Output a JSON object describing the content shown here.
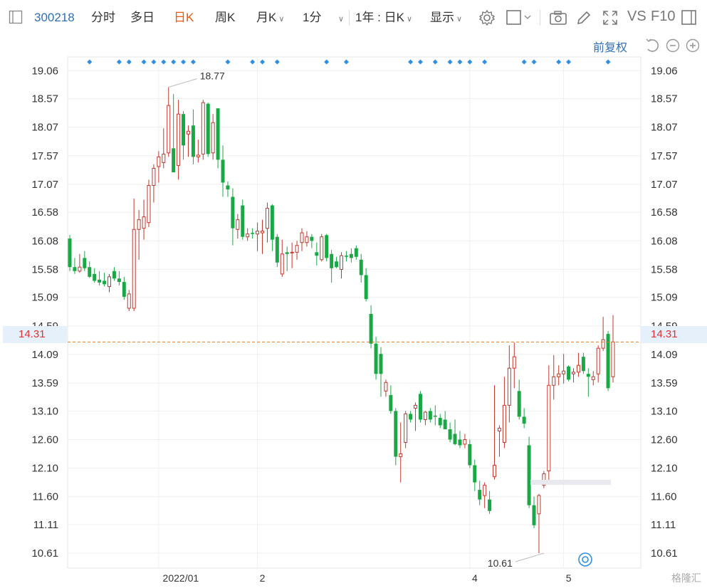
{
  "toolbar": {
    "code": "300218",
    "tabs": [
      {
        "label": "分时",
        "active": false
      },
      {
        "label": "多日",
        "active": false
      },
      {
        "label": "日K",
        "active": true
      },
      {
        "label": "周K",
        "active": false
      },
      {
        "label": "月K",
        "active": false
      },
      {
        "label": "1分",
        "active": false
      }
    ],
    "range": "1年 : 日K",
    "display": "显示",
    "vs": "VS",
    "f10": "F10",
    "icons": [
      "gear-icon",
      "box-icon",
      "camera-icon",
      "pencil-icon",
      "expand-icon",
      "panel-icon"
    ]
  },
  "subbar": {
    "adjust": "前复权",
    "icons": [
      "undo-icon",
      "zoom-out-icon",
      "zoom-in-icon"
    ]
  },
  "current_price": "14.31",
  "watermark": "格隆汇",
  "colors": {
    "up": "#c0392b",
    "down": "#1aa845",
    "accent": "#2f6fb8",
    "price_line": "#e07b1e"
  },
  "chart_data": {
    "type": "candlestick",
    "ylim": [
      10.35,
      19.3
    ],
    "y_ticks": [
      "19.06",
      "18.57",
      "18.07",
      "17.57",
      "17.07",
      "16.58",
      "16.08",
      "15.58",
      "15.09",
      "14.59",
      "14.09",
      "13.59",
      "13.10",
      "12.60",
      "12.10",
      "11.60",
      "11.11",
      "10.61"
    ],
    "x_ticks": [
      {
        "label": "2022/01",
        "index": 18
      },
      {
        "label": "2",
        "index": 38
      },
      {
        "label": "4",
        "index": 81
      },
      {
        "label": "5",
        "index": 100
      }
    ],
    "annotations": {
      "high": {
        "label": "18.77",
        "index": 20,
        "value": 18.77
      },
      "low": {
        "label": "10.61",
        "index": 96,
        "value": 10.61
      }
    },
    "event_marker_indices": [
      4,
      10,
      12,
      15,
      17,
      19,
      21,
      23,
      25,
      32,
      37,
      39,
      42,
      52,
      56,
      69,
      71,
      74,
      77,
      79,
      81,
      84,
      92,
      94,
      99,
      101,
      109
    ],
    "candles": [
      {
        "o": 16.12,
        "h": 16.18,
        "l": 15.55,
        "c": 15.62
      },
      {
        "o": 15.62,
        "h": 15.78,
        "l": 15.5,
        "c": 15.55
      },
      {
        "o": 15.55,
        "h": 15.85,
        "l": 15.52,
        "c": 15.62
      },
      {
        "o": 15.78,
        "h": 15.9,
        "l": 15.55,
        "c": 15.6
      },
      {
        "o": 15.62,
        "h": 15.72,
        "l": 15.43,
        "c": 15.45
      },
      {
        "o": 15.5,
        "h": 15.6,
        "l": 15.35,
        "c": 15.38
      },
      {
        "o": 15.4,
        "h": 15.55,
        "l": 15.3,
        "c": 15.35
      },
      {
        "o": 15.38,
        "h": 15.52,
        "l": 15.28,
        "c": 15.32
      },
      {
        "o": 15.28,
        "h": 15.5,
        "l": 15.18,
        "c": 15.45
      },
      {
        "o": 15.55,
        "h": 15.62,
        "l": 15.38,
        "c": 15.42
      },
      {
        "o": 15.42,
        "h": 15.55,
        "l": 15.3,
        "c": 15.36
      },
      {
        "o": 15.36,
        "h": 15.45,
        "l": 15.05,
        "c": 15.1
      },
      {
        "o": 14.9,
        "h": 15.22,
        "l": 14.85,
        "c": 15.15
      },
      {
        "o": 14.9,
        "h": 16.82,
        "l": 14.85,
        "c": 16.28
      },
      {
        "o": 16.28,
        "h": 16.62,
        "l": 15.75,
        "c": 16.45
      },
      {
        "o": 16.3,
        "h": 16.8,
        "l": 16.1,
        "c": 16.5
      },
      {
        "o": 16.4,
        "h": 17.15,
        "l": 16.32,
        "c": 17.05
      },
      {
        "o": 17.05,
        "h": 17.42,
        "l": 16.75,
        "c": 17.35
      },
      {
        "o": 17.38,
        "h": 17.65,
        "l": 17.1,
        "c": 17.55
      },
      {
        "o": 17.45,
        "h": 18.05,
        "l": 17.35,
        "c": 17.6
      },
      {
        "o": 17.62,
        "h": 18.77,
        "l": 17.55,
        "c": 18.45
      },
      {
        "o": 17.7,
        "h": 18.65,
        "l": 17.6,
        "c": 17.28
      },
      {
        "o": 17.4,
        "h": 18.55,
        "l": 17.15,
        "c": 18.3
      },
      {
        "o": 18.3,
        "h": 18.35,
        "l": 17.5,
        "c": 17.75
      },
      {
        "o": 17.95,
        "h": 18.1,
        "l": 17.55,
        "c": 18.0
      },
      {
        "o": 18.1,
        "h": 18.38,
        "l": 17.42,
        "c": 17.55
      },
      {
        "o": 17.55,
        "h": 17.85,
        "l": 17.45,
        "c": 17.58
      },
      {
        "o": 17.6,
        "h": 18.55,
        "l": 17.5,
        "c": 18.5
      },
      {
        "o": 18.48,
        "h": 18.5,
        "l": 17.55,
        "c": 17.6
      },
      {
        "o": 17.62,
        "h": 18.3,
        "l": 17.5,
        "c": 18.15
      },
      {
        "o": 18.4,
        "h": 18.4,
        "l": 17.35,
        "c": 17.5
      },
      {
        "o": 17.5,
        "h": 17.75,
        "l": 16.85,
        "c": 17.1
      },
      {
        "o": 17.05,
        "h": 17.12,
        "l": 16.85,
        "c": 16.98
      },
      {
        "o": 16.85,
        "h": 17.0,
        "l": 16.0,
        "c": 16.3
      },
      {
        "o": 16.28,
        "h": 16.55,
        "l": 16.12,
        "c": 16.45
      },
      {
        "o": 16.7,
        "h": 16.8,
        "l": 16.1,
        "c": 16.15
      },
      {
        "o": 16.15,
        "h": 16.3,
        "l": 16.08,
        "c": 16.2
      },
      {
        "o": 16.22,
        "h": 16.3,
        "l": 16.12,
        "c": 16.2
      },
      {
        "o": 16.2,
        "h": 16.4,
        "l": 15.9,
        "c": 16.25
      },
      {
        "o": 16.22,
        "h": 16.45,
        "l": 15.85,
        "c": 16.25
      },
      {
        "o": 16.3,
        "h": 16.75,
        "l": 16.05,
        "c": 16.65
      },
      {
        "o": 16.7,
        "h": 16.72,
        "l": 15.9,
        "c": 16.1
      },
      {
        "o": 16.15,
        "h": 16.2,
        "l": 15.62,
        "c": 15.7
      },
      {
        "o": 15.5,
        "h": 16.1,
        "l": 15.45,
        "c": 15.85
      },
      {
        "o": 15.88,
        "h": 15.98,
        "l": 15.55,
        "c": 15.85
      },
      {
        "o": 15.88,
        "h": 16.05,
        "l": 15.6,
        "c": 15.88
      },
      {
        "o": 15.88,
        "h": 16.08,
        "l": 15.75,
        "c": 16.0
      },
      {
        "o": 16.05,
        "h": 16.3,
        "l": 15.9,
        "c": 16.22
      },
      {
        "o": 16.05,
        "h": 16.25,
        "l": 15.98,
        "c": 16.15
      },
      {
        "o": 16.15,
        "h": 16.2,
        "l": 15.95,
        "c": 16.08
      },
      {
        "o": 15.88,
        "h": 16.05,
        "l": 15.65,
        "c": 15.82
      },
      {
        "o": 15.75,
        "h": 16.2,
        "l": 15.72,
        "c": 16.15
      },
      {
        "o": 16.18,
        "h": 16.2,
        "l": 15.72,
        "c": 15.78
      },
      {
        "o": 15.85,
        "h": 15.92,
        "l": 15.35,
        "c": 15.6
      },
      {
        "o": 15.72,
        "h": 15.8,
        "l": 15.6,
        "c": 15.62
      },
      {
        "o": 15.58,
        "h": 15.88,
        "l": 15.42,
        "c": 15.82
      },
      {
        "o": 15.82,
        "h": 15.9,
        "l": 15.72,
        "c": 15.8
      },
      {
        "o": 15.85,
        "h": 15.95,
        "l": 15.7,
        "c": 15.78
      },
      {
        "o": 15.95,
        "h": 16.0,
        "l": 15.75,
        "c": 15.8
      },
      {
        "o": 15.75,
        "h": 15.85,
        "l": 15.35,
        "c": 15.48
      },
      {
        "o": 15.48,
        "h": 15.6,
        "l": 15.02,
        "c": 15.06
      },
      {
        "o": 14.8,
        "h": 14.95,
        "l": 14.2,
        "c": 14.28
      },
      {
        "o": 14.28,
        "h": 14.4,
        "l": 13.65,
        "c": 13.75
      },
      {
        "o": 14.1,
        "h": 14.22,
        "l": 13.35,
        "c": 13.75
      },
      {
        "o": 13.45,
        "h": 13.65,
        "l": 13.35,
        "c": 13.6
      },
      {
        "o": 13.38,
        "h": 13.55,
        "l": 13.05,
        "c": 13.1
      },
      {
        "o": 13.1,
        "h": 13.15,
        "l": 12.15,
        "c": 12.3
      },
      {
        "o": 12.3,
        "h": 12.9,
        "l": 11.85,
        "c": 12.35
      },
      {
        "o": 12.55,
        "h": 13.1,
        "l": 12.45,
        "c": 13.05
      },
      {
        "o": 13.05,
        "h": 13.1,
        "l": 12.9,
        "c": 12.95
      },
      {
        "o": 13.15,
        "h": 13.25,
        "l": 12.75,
        "c": 13.2
      },
      {
        "o": 13.4,
        "h": 13.45,
        "l": 12.9,
        "c": 12.95
      },
      {
        "o": 12.95,
        "h": 13.1,
        "l": 12.85,
        "c": 13.08
      },
      {
        "o": 13.1,
        "h": 13.15,
        "l": 12.9,
        "c": 12.95
      },
      {
        "o": 13.02,
        "h": 13.2,
        "l": 12.85,
        "c": 13.0
      },
      {
        "o": 12.98,
        "h": 13.05,
        "l": 12.8,
        "c": 12.85
      },
      {
        "o": 12.95,
        "h": 13.1,
        "l": 12.8,
        "c": 12.78
      },
      {
        "o": 12.78,
        "h": 12.9,
        "l": 12.55,
        "c": 12.6
      },
      {
        "o": 12.7,
        "h": 12.95,
        "l": 12.5,
        "c": 12.52
      },
      {
        "o": 12.6,
        "h": 12.75,
        "l": 12.45,
        "c": 12.5
      },
      {
        "o": 12.52,
        "h": 12.7,
        "l": 12.45,
        "c": 12.6
      },
      {
        "o": 12.52,
        "h": 12.6,
        "l": 12.1,
        "c": 12.15
      },
      {
        "o": 12.15,
        "h": 12.25,
        "l": 11.7,
        "c": 11.85
      },
      {
        "o": 11.72,
        "h": 11.88,
        "l": 11.45,
        "c": 11.55
      },
      {
        "o": 11.62,
        "h": 11.85,
        "l": 11.4,
        "c": 11.8
      },
      {
        "o": 11.55,
        "h": 11.7,
        "l": 11.3,
        "c": 11.35
      },
      {
        "o": 11.95,
        "h": 13.55,
        "l": 11.9,
        "c": 12.15
      },
      {
        "o": 12.75,
        "h": 12.85,
        "l": 12.3,
        "c": 12.8
      },
      {
        "o": 12.55,
        "h": 13.7,
        "l": 12.45,
        "c": 13.2
      },
      {
        "o": 13.2,
        "h": 14.25,
        "l": 12.9,
        "c": 13.85
      },
      {
        "o": 13.85,
        "h": 14.3,
        "l": 13.5,
        "c": 14.05
      },
      {
        "o": 13.45,
        "h": 13.65,
        "l": 12.95,
        "c": 13.0
      },
      {
        "o": 13.0,
        "h": 13.15,
        "l": 12.8,
        "c": 12.88
      },
      {
        "o": 12.5,
        "h": 12.65,
        "l": 11.4,
        "c": 11.45
      },
      {
        "o": 11.45,
        "h": 11.6,
        "l": 11.05,
        "c": 11.1
      },
      {
        "o": 11.3,
        "h": 11.65,
        "l": 10.61,
        "c": 11.62
      },
      {
        "o": 11.8,
        "h": 12.05,
        "l": 11.75,
        "c": 12.0
      },
      {
        "o": 12.05,
        "h": 13.9,
        "l": 11.85,
        "c": 13.55
      },
      {
        "o": 13.55,
        "h": 14.08,
        "l": 13.3,
        "c": 13.7
      },
      {
        "o": 13.7,
        "h": 13.9,
        "l": 13.55,
        "c": 13.75
      },
      {
        "o": 13.75,
        "h": 14.1,
        "l": 13.58,
        "c": 13.8
      },
      {
        "o": 13.88,
        "h": 13.9,
        "l": 13.62,
        "c": 13.65
      },
      {
        "o": 13.75,
        "h": 13.85,
        "l": 13.6,
        "c": 13.78
      },
      {
        "o": 13.78,
        "h": 14.12,
        "l": 13.7,
        "c": 13.9
      },
      {
        "o": 14.05,
        "h": 14.12,
        "l": 13.75,
        "c": 13.8
      },
      {
        "o": 13.75,
        "h": 13.85,
        "l": 13.35,
        "c": 13.7
      },
      {
        "o": 13.65,
        "h": 13.8,
        "l": 13.55,
        "c": 13.7
      },
      {
        "o": 13.75,
        "h": 14.25,
        "l": 13.6,
        "c": 14.2
      },
      {
        "o": 14.2,
        "h": 14.75,
        "l": 14.15,
        "c": 14.35
      },
      {
        "o": 14.45,
        "h": 14.5,
        "l": 13.45,
        "c": 13.5
      },
      {
        "o": 13.7,
        "h": 14.78,
        "l": 13.6,
        "c": 14.31
      }
    ]
  }
}
